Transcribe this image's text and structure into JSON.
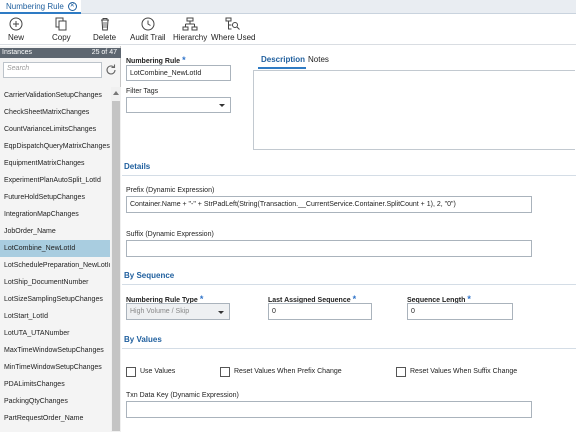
{
  "tab": {
    "title": "Numbering Rule",
    "close_icon": "close-circle-icon"
  },
  "toolbar": {
    "new": "New",
    "copy": "Copy",
    "delete": "Delete",
    "audit_trail": "Audit Trail",
    "hierarchy": "Hierarchy",
    "where_used": "Where Used"
  },
  "instances": {
    "header": "Instances",
    "count": "25 of 47",
    "search_placeholder": "Search",
    "selected": "LotCombine_NewLotId",
    "items": [
      "CarrierValidationSetupChanges",
      "CheckSheetMatrixChanges",
      "CountVarianceLimitsChanges",
      "EqpDispatchQueryMatrixChanges",
      "EquipmentMatrixChanges",
      "ExperimentPlanAutoSplit_LotId",
      "FutureHoldSetupChanges",
      "IntegrationMapChanges",
      "JobOrder_Name",
      "LotCombine_NewLotId",
      "LotSchedulePreparation_NewLotId",
      "LotShip_DocumentNumber",
      "LotSizeSamplingSetupChanges",
      "LotStart_LotId",
      "LotUTA_UTANumber",
      "MaxTimeWindowSetupChanges",
      "MinTimeWindowSetupChanges",
      "PDALimitsChanges",
      "PackingQtyChanges",
      "PartRequestOrder_Name"
    ]
  },
  "form": {
    "numbering_rule_label": "Numbering Rule",
    "numbering_rule_value": "LotCombine_NewLotId",
    "filter_tags_label": "Filter Tags",
    "description_tab": "Description",
    "notes_tab": "Notes",
    "details_section": "Details",
    "prefix_label": "Prefix (Dynamic Expression)",
    "prefix_value": "Container.Name + \"-\" + StrPadLeft(String(Transaction.__CurrentService.Container.SplitCount + 1), 2, \"0\")",
    "suffix_label": "Suffix (Dynamic Expression)",
    "suffix_value": "",
    "by_sequence_section": "By Sequence",
    "rule_type_label": "Numbering Rule Type",
    "rule_type_value": "High Volume / Skip",
    "last_seq_label": "Last Assigned Sequence",
    "last_seq_value": "0",
    "seq_length_label": "Sequence Length",
    "seq_length_value": "0",
    "by_values_section": "By Values",
    "use_values_label": "Use Values",
    "reset_prefix_label": "Reset Values When Prefix Change",
    "reset_suffix_label": "Reset Values When Suffix Change",
    "txn_key_label": "Txn Data Key (Dynamic Expression)",
    "txn_key_value": ""
  },
  "colors": {
    "accent": "#1f5f9e",
    "selected_row": "#a9cde0",
    "required_star": "#2f73c9"
  }
}
